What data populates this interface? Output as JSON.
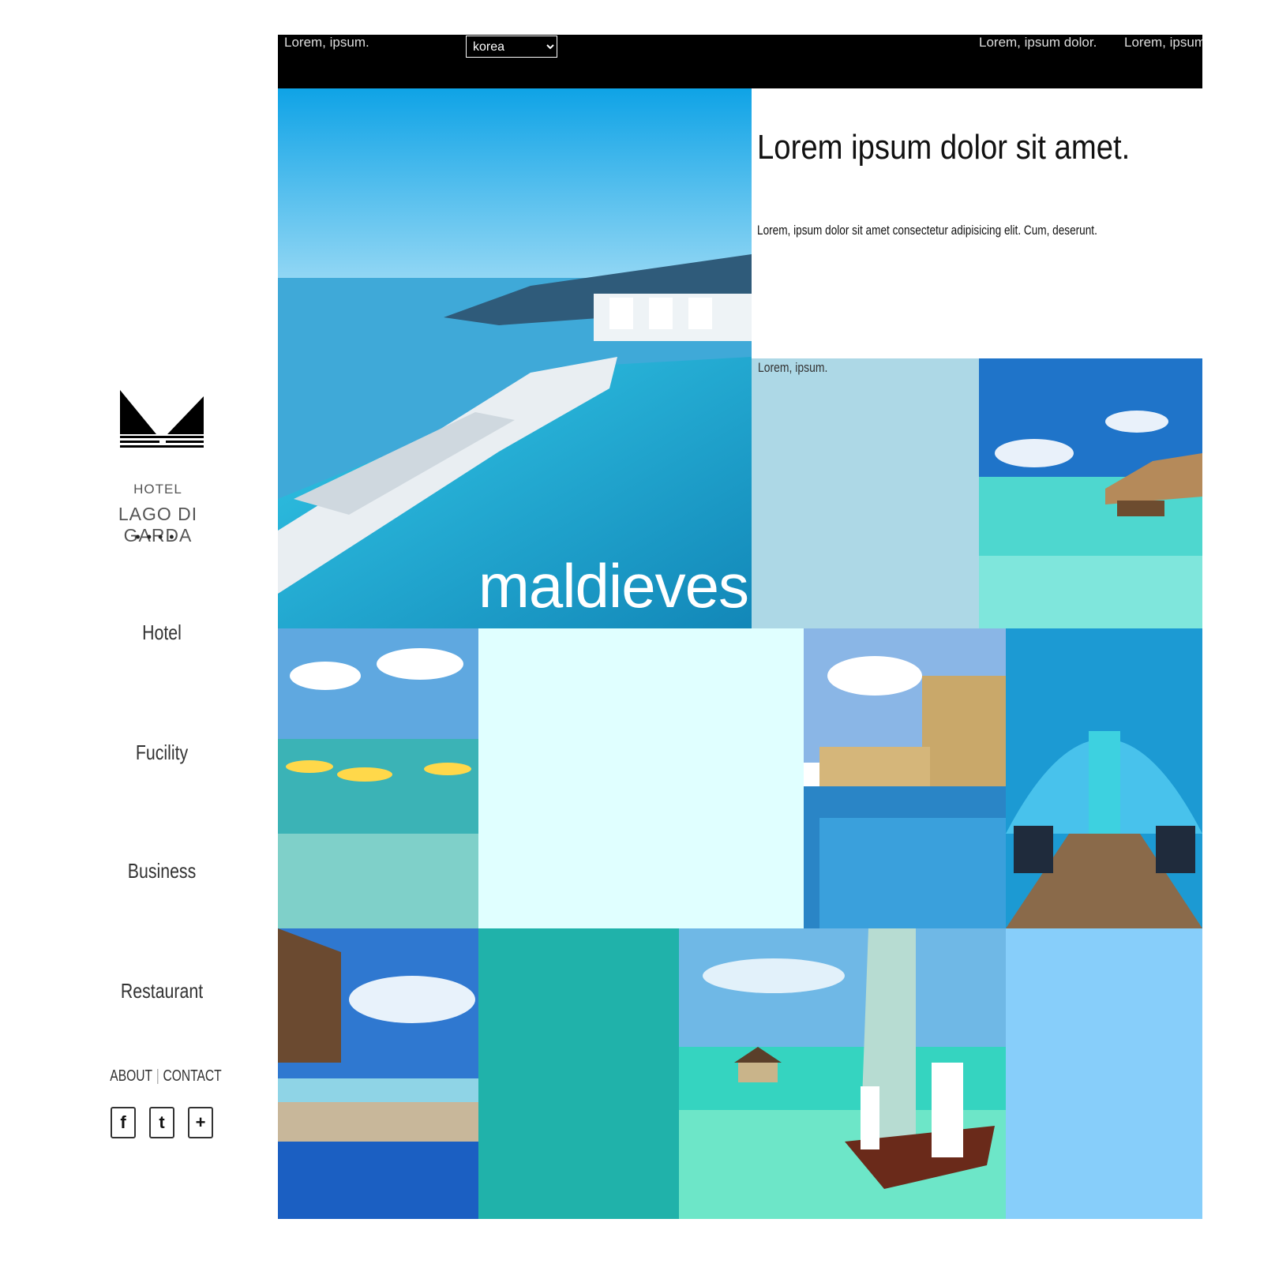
{
  "topbar": {
    "left_text": "Lorem, ipsum.",
    "region_select": {
      "selected": "korea",
      "options": [
        "korea"
      ]
    },
    "links": [
      "Lorem, ipsum dolor.",
      "Lorem, ipsum"
    ]
  },
  "brand": {
    "line1": "HOTEL",
    "line2": "LAGO DI GARDA",
    "stars": "••••"
  },
  "nav": {
    "items": [
      "Hotel",
      "Fucility",
      "Business",
      "Restaurant"
    ]
  },
  "footer": {
    "about": "ABOUT",
    "separator": "|",
    "contact": "CONTACT"
  },
  "social": {
    "facebook": "f",
    "twitter": "t",
    "plus": "+"
  },
  "hero": {
    "caption": "maldieves"
  },
  "intro": {
    "title": "Lorem ipsum dolor sit amet.",
    "text": "Lorem, ipsum dolor sit amet consectetur adipisicing elit. Cum, deserunt."
  },
  "tile": {
    "label": "Lorem, ipsum."
  },
  "colors": {
    "topbar": "#000000",
    "tile_lightblue": "#add8e6",
    "tile_lightcyan": "#e0ffff",
    "tile_teal": "#20b2aa",
    "tile_skyblue": "#87cefa"
  }
}
